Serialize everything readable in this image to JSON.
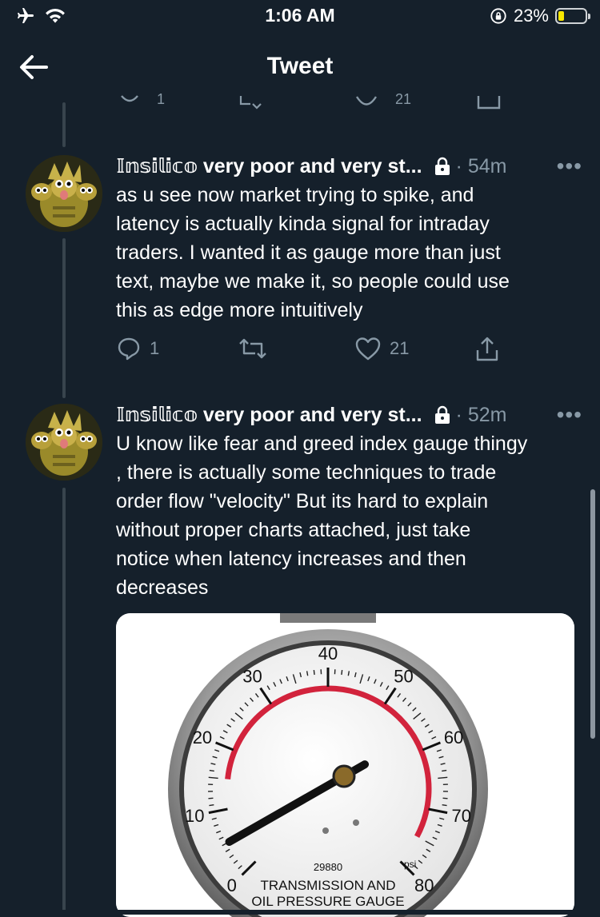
{
  "status_bar": {
    "time": "1:06 AM",
    "battery": "23%",
    "battery_level": 0.23
  },
  "header": {
    "title": "Tweet"
  },
  "previous_tweet_actions": {
    "reply_count": "1",
    "like_count": "21"
  },
  "tweets": [
    {
      "author": "𝕀𝕟𝕤𝕚𝕝𝕚𝕔𝕠 very poor and very st...",
      "time": "· 54m",
      "more": "•••",
      "text_lines": [
        "as u see now market trying to spike, and",
        "latency is actually kinda signal for intraday",
        "traders. I wanted it as gauge more than just",
        "text, maybe we make it, so people could use",
        "this as edge more intuitively"
      ],
      "reply_count": "1",
      "like_count": "21"
    },
    {
      "author": "𝕀𝕟𝕤𝕚𝕝𝕚𝕔𝕠 very poor and very st...",
      "time": "· 52m",
      "more": "•••",
      "text_lines": [
        "U know like fear and greed index gauge thingy",
        ", there is actually some techniques to trade",
        "order flow \"velocity\" But its hard to explain",
        "without proper charts attached, just take",
        "notice when latency increases and then",
        "decreases"
      ]
    }
  ],
  "gauge_image": {
    "ticks": [
      "0",
      "10",
      "20",
      "30",
      "40",
      "50",
      "60",
      "70",
      "80"
    ],
    "unit": "psi",
    "serial": "29880",
    "label_line1": "TRANSMISSION AND",
    "label_line2": "OIL PRESSURE GAUGE",
    "needle_value": 5
  },
  "colors": {
    "background": "#15202b",
    "muted": "#8899a6",
    "thread_line": "#38444d",
    "gauge_red": "#d2233c"
  }
}
